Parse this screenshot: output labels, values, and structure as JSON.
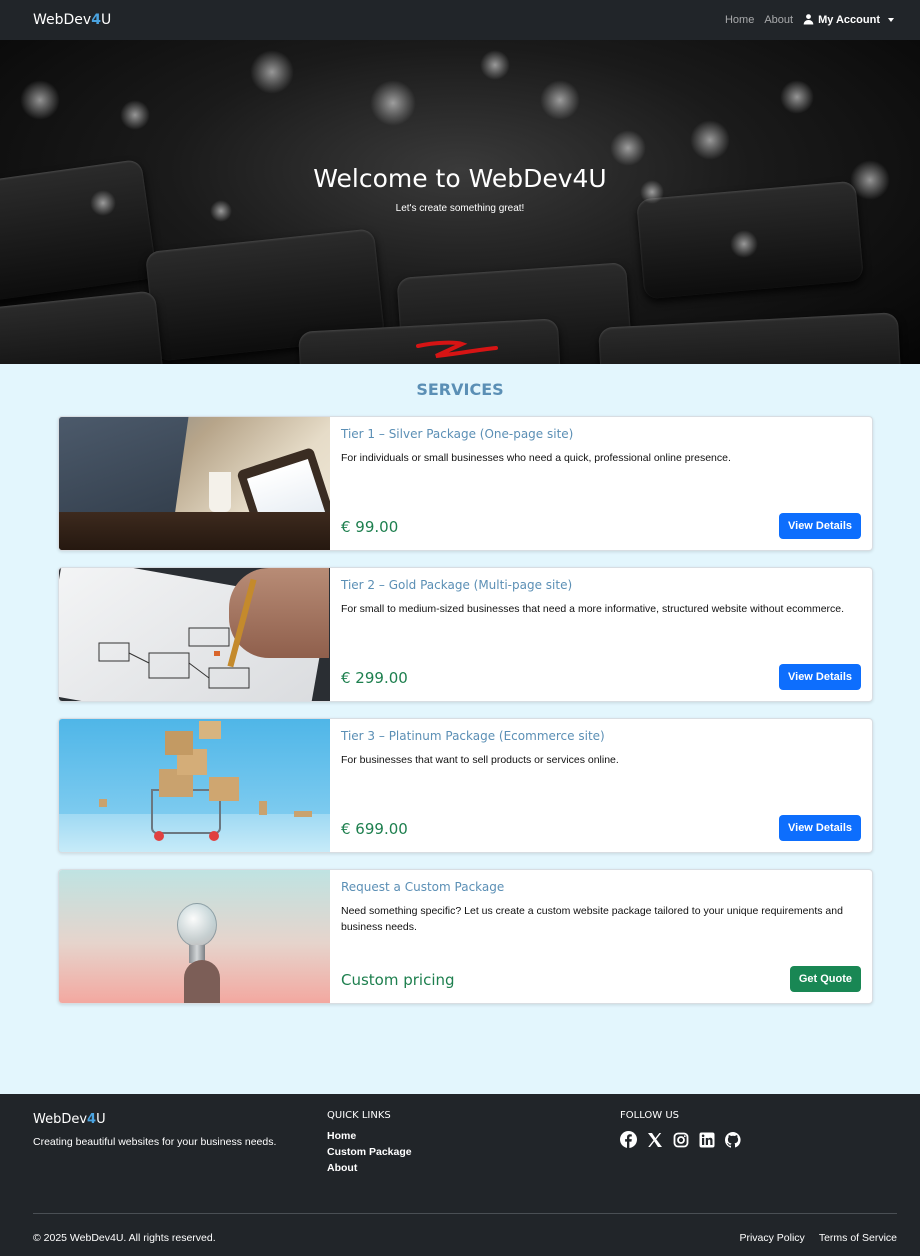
{
  "nav": {
    "brand_prefix": "WebDev",
    "brand_highlight": "4",
    "brand_suffix": "U",
    "links": [
      "Home",
      "About"
    ],
    "account_label": "My Account",
    "account_icon": "person-icon"
  },
  "hero": {
    "title": "Welcome to WebDev4U",
    "subtitle": "Let's create something great!"
  },
  "services": {
    "heading": "SERVICES",
    "cards": [
      {
        "title": "Tier 1 – Silver Package (One-page site)",
        "description": "For individuals or small businesses who need a quick, professional online presence.",
        "price": "€ 99.00",
        "button": "View Details"
      },
      {
        "title": "Tier 2 – Gold Package (Multi-page site)",
        "description": "For small to medium-sized businesses that need a more informative, structured website without ecommerce.",
        "price": "€ 299.00",
        "button": "View Details"
      },
      {
        "title": "Tier 3 – Platinum Package (Ecommerce site)",
        "description": "For businesses that want to sell products or services online.",
        "price": "€ 699.00",
        "button": "View Details"
      },
      {
        "title": "Request a Custom Package",
        "description": "Need something specific? Let us create a custom website package tailored to your unique requirements and business needs.",
        "price": "Custom pricing",
        "button": "Get Quote"
      }
    ]
  },
  "footer": {
    "brand_prefix": "WebDev",
    "brand_highlight": "4",
    "brand_suffix": "U",
    "tagline": "Creating beautiful websites for your business needs.",
    "quick_links_title": "QUICK LINKS",
    "quick_links": [
      "Home",
      "Custom Package",
      "About"
    ],
    "follow_title": "FOLLOW US",
    "socials": [
      "facebook-icon",
      "x-icon",
      "instagram-icon",
      "linkedin-icon",
      "github-icon"
    ],
    "copyright": "© 2025 WebDev4U. All rights reserved.",
    "legal": [
      "Privacy Policy",
      "Terms of Service"
    ]
  },
  "colors": {
    "navbar_bg": "#212529",
    "page_bg": "#e3f6fd",
    "accent_blue": "#0d6efd",
    "accent_green": "#198754",
    "price_green": "#1d7f4e",
    "heading_blue": "#5b8fb5"
  }
}
